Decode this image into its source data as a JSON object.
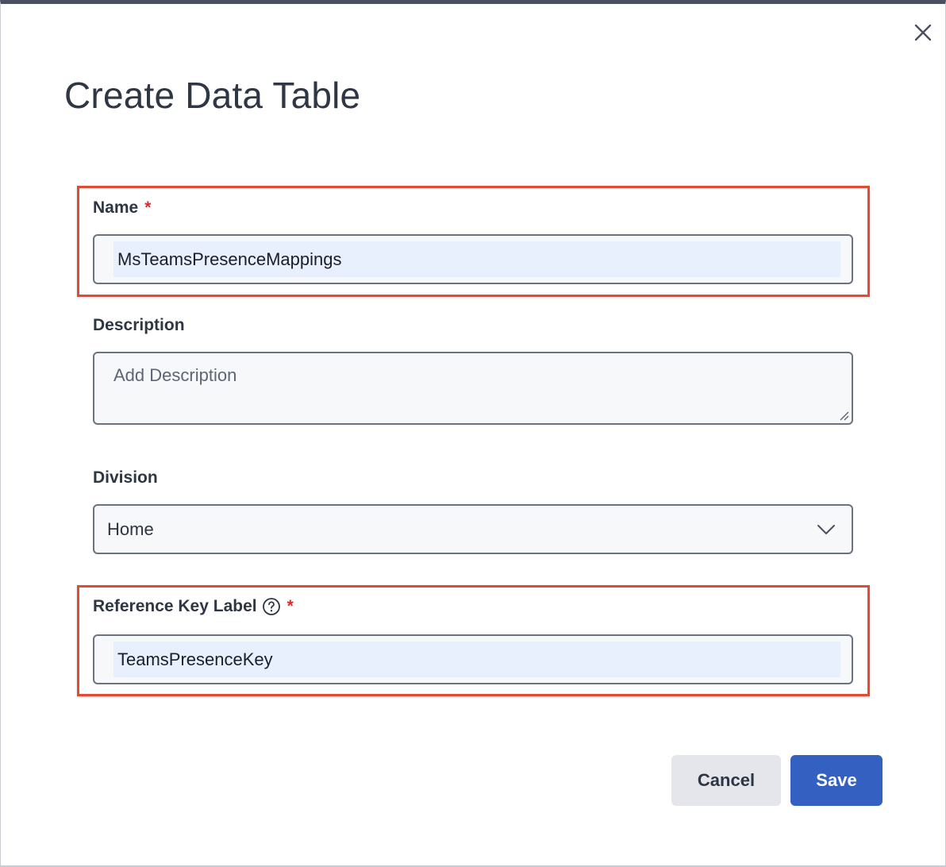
{
  "dialog": {
    "title": "Create Data Table",
    "close_icon": "close-icon"
  },
  "form": {
    "name": {
      "label": "Name",
      "required_marker": "*",
      "value": "MsTeamsPresenceMappings"
    },
    "description": {
      "label": "Description",
      "placeholder": "Add Description",
      "value": ""
    },
    "division": {
      "label": "Division",
      "selected": "Home",
      "icon": "chevron-down-icon"
    },
    "reference_key": {
      "label": "Reference Key Label",
      "help_icon": "help-circle-icon",
      "required_marker": "*",
      "value": "TeamsPresenceKey"
    }
  },
  "actions": {
    "cancel_label": "Cancel",
    "save_label": "Save"
  },
  "colors": {
    "highlight": "#e24a33",
    "primary": "#3461c1",
    "required": "#d92b2b"
  }
}
